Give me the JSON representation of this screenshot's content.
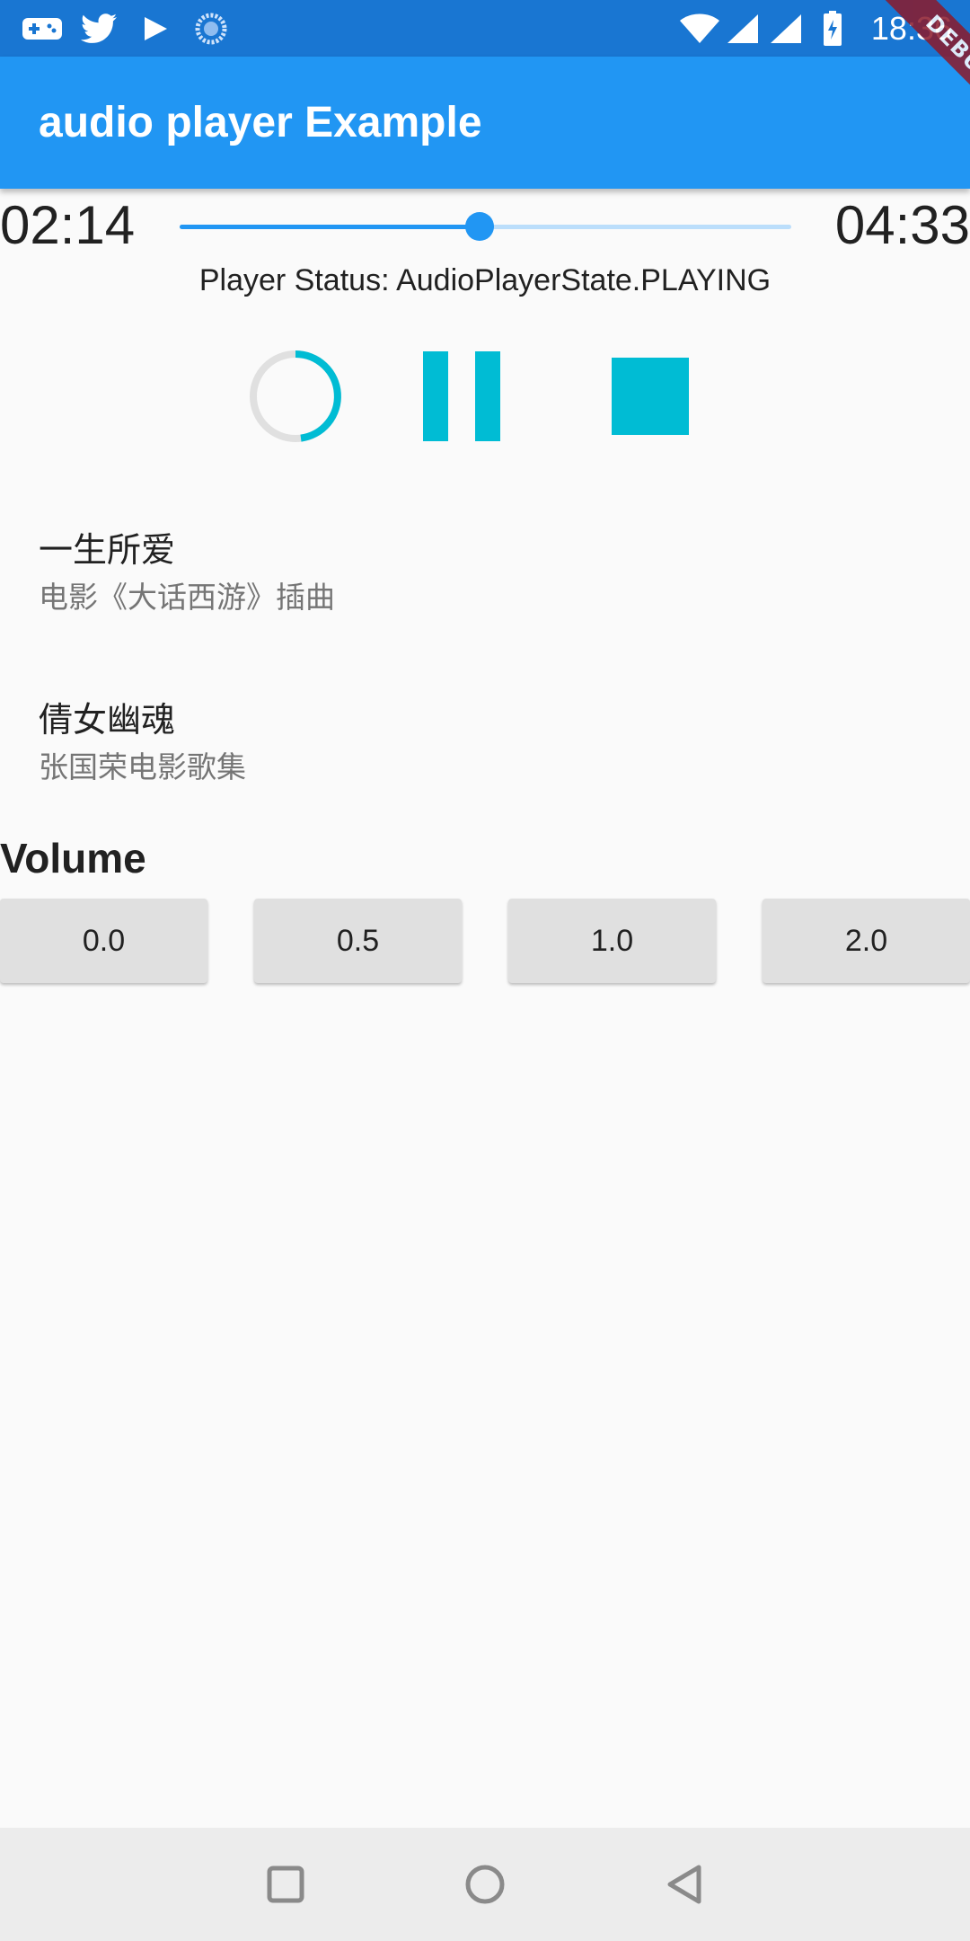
{
  "status_bar": {
    "time": "18:36",
    "icons": [
      "gamepad-icon",
      "twitter-icon",
      "play-store-icon",
      "sync-icon",
      "wifi-icon",
      "cell-signal-icon",
      "cell-signal-icon",
      "battery-charging-icon"
    ]
  },
  "app_bar": {
    "title": "audio player Example"
  },
  "debug_banner": "DEBUG",
  "player": {
    "position": "02:14",
    "duration": "04:33",
    "progress": 0.49,
    "status": "Player Status: AudioPlayerState.PLAYING",
    "controls": [
      "loading-spinner-icon",
      "pause-icon",
      "stop-icon"
    ]
  },
  "tracks": [
    {
      "title": "一生所爱",
      "subtitle": "电影《大话西游》插曲"
    },
    {
      "title": "倩女幽魂",
      "subtitle": "张国荣电影歌集"
    }
  ],
  "volume": {
    "title": "Volume",
    "options": [
      "0.0",
      "0.5",
      "1.0",
      "2.0"
    ]
  },
  "colors": {
    "status_bar": "#1976d2",
    "app_bar": "#2196f3",
    "accent": "#00bcd4",
    "slider": "#2196f3"
  }
}
